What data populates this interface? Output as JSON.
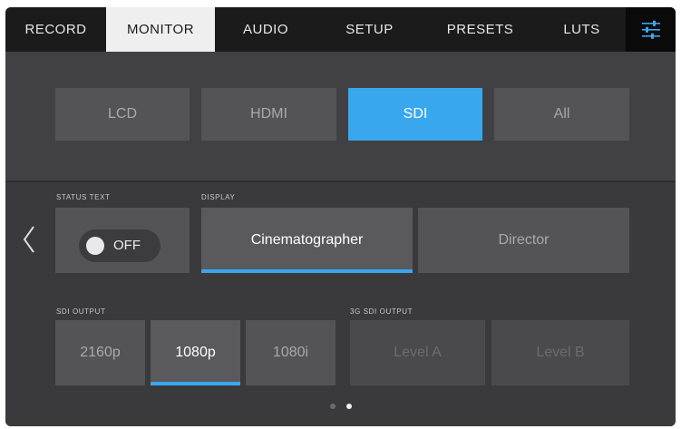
{
  "tabs": [
    {
      "label": "RECORD",
      "active": false
    },
    {
      "label": "MONITOR",
      "active": true
    },
    {
      "label": "AUDIO",
      "active": false
    },
    {
      "label": "SETUP",
      "active": false
    },
    {
      "label": "PRESETS",
      "active": false
    },
    {
      "label": "LUTS",
      "active": false
    }
  ],
  "settings_icon": "sliders-icon",
  "outputs": {
    "options": [
      "LCD",
      "HDMI",
      "SDI",
      "All"
    ],
    "selected": "SDI"
  },
  "status_text": {
    "label": "STATUS TEXT",
    "value": "OFF"
  },
  "display": {
    "label": "DISPLAY",
    "options": [
      "Cinematographer",
      "Director"
    ],
    "selected": "Cinematographer"
  },
  "sdi_output": {
    "label": "SDI OUTPUT",
    "options": [
      "2160p",
      "1080p",
      "1080i"
    ],
    "selected": "1080p"
  },
  "sdi_3g_output": {
    "label": "3G SDI OUTPUT",
    "options": [
      "Level A",
      "Level B"
    ]
  },
  "page_indicator": {
    "total": 2,
    "current": 2
  },
  "colors": {
    "accent": "#39a7ee",
    "tab_active": "#efefef"
  }
}
